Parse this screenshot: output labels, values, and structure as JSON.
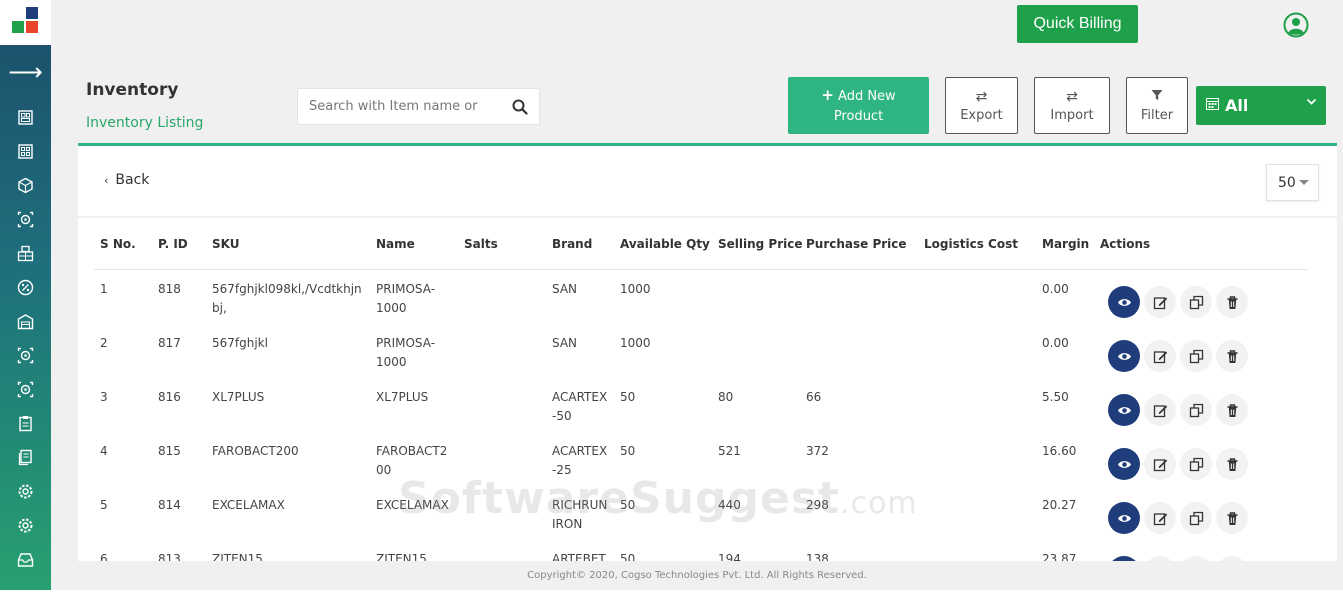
{
  "topbar": {
    "quick_billing_label": "Quick Billing"
  },
  "header": {
    "title": "Inventory",
    "subtitle": "Inventory Listing",
    "search_placeholder": "Search with Item name or",
    "add_product_line1": "Add New",
    "add_product_line2": "Product",
    "export_label": "Export",
    "import_label": "Import",
    "filter_label": "Filter",
    "date_filter_value": "All"
  },
  "card": {
    "back_label": "Back",
    "per_page_value": "50"
  },
  "table": {
    "columns": [
      "S No.",
      "P. ID",
      "SKU",
      "Name",
      "Salts",
      "Brand",
      "Available Qty",
      "Selling Price",
      "Purchase Price",
      "Logistics Cost",
      "Margin",
      "Actions"
    ],
    "rows": [
      {
        "sno": "1",
        "pid": "818",
        "sku": "567fghjkl098kl,/Vcdtkhjn\nbj,",
        "name": "PRIMOSA-\n1000",
        "salts": "",
        "brand": "SAN",
        "qty": "1000",
        "selling": "",
        "purchase": "",
        "logistics": "",
        "margin": "0.00"
      },
      {
        "sno": "2",
        "pid": "817",
        "sku": "567fghjkl",
        "name": "PRIMOSA-\n1000",
        "salts": "",
        "brand": "SAN",
        "qty": "1000",
        "selling": "",
        "purchase": "",
        "logistics": "",
        "margin": "0.00"
      },
      {
        "sno": "3",
        "pid": "816",
        "sku": "XL7PLUS",
        "name": "XL7PLUS",
        "salts": "",
        "brand": "ACARTEX\n-50",
        "qty": "50",
        "selling": "80",
        "purchase": "66",
        "logistics": "",
        "margin": "5.50"
      },
      {
        "sno": "4",
        "pid": "815",
        "sku": "FAROBACT200",
        "name": "FAROBACT2\n00",
        "salts": "",
        "brand": "ACARTEX\n-25",
        "qty": "50",
        "selling": "521",
        "purchase": "372",
        "logistics": "",
        "margin": "16.60"
      },
      {
        "sno": "5",
        "pid": "814",
        "sku": "EXCELAMAX",
        "name": "EXCELAMAX",
        "salts": "",
        "brand": "RICHRUN\nIRON",
        "qty": "50",
        "selling": "440",
        "purchase": "298",
        "logistics": "",
        "margin": "20.27"
      },
      {
        "sno": "6",
        "pid": "813",
        "sku": "ZITEN15",
        "name": "ZITEN15",
        "salts": "",
        "brand": "ARTEBET",
        "qty": "50",
        "selling": "194",
        "purchase": "138",
        "logistics": "",
        "margin": "23.87"
      }
    ]
  },
  "watermark": {
    "main": "SoftwareSuggest",
    "suffix": ".com"
  },
  "footer": {
    "copyright": "Copyright© 2020, Cogso Technologies Pvt. Ltd. All Rights Reserved."
  },
  "colors": {
    "brand_green": "#1fa04a",
    "accent_teal": "#2fb581",
    "view_blue": "#1e3d7a"
  },
  "sidebar": {
    "icons": [
      "dashboard-icon",
      "grid-icon",
      "box-icon",
      "target-icon",
      "building-icon",
      "percent-icon",
      "warehouse-icon",
      "target-icon",
      "target-icon",
      "clipboard-icon",
      "document-icon",
      "settings-icon",
      "settings-icon",
      "inbox-icon"
    ]
  }
}
